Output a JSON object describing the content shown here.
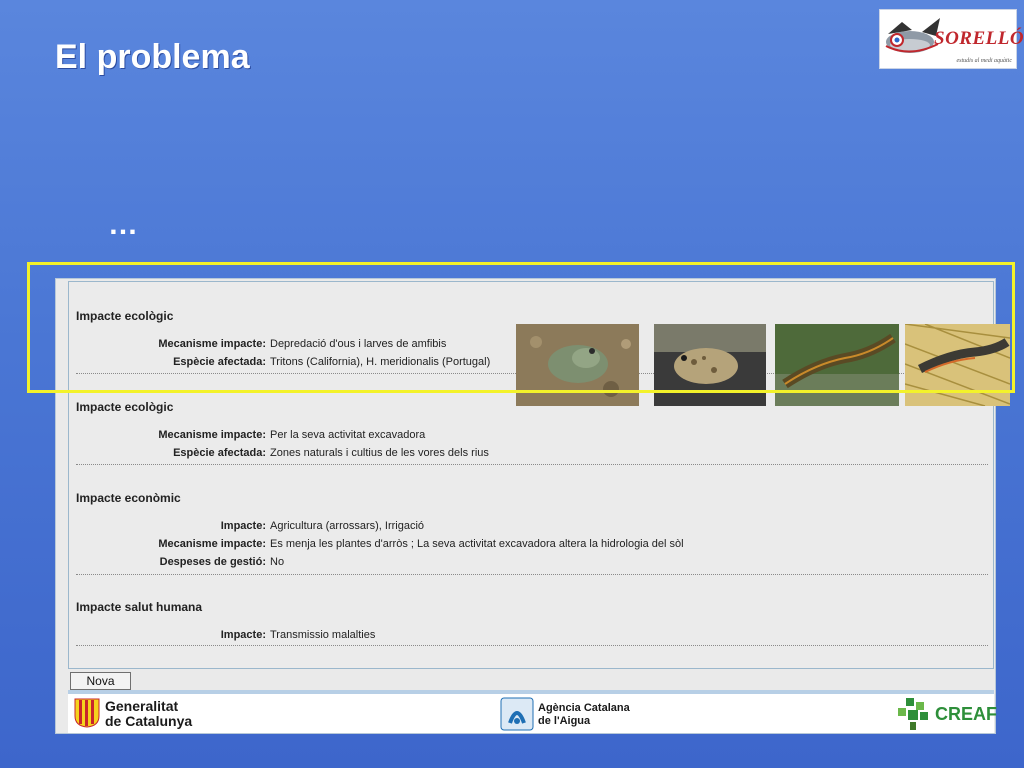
{
  "slide": {
    "title": "El problema",
    "ellipsis": "…"
  },
  "logo": {
    "brand": "SORELLÓ",
    "tagline": "estudis al medi aquàtic"
  },
  "impacts": [
    {
      "heading": "Impacte ecològic",
      "rows": [
        {
          "label": "Mecanisme impacte:",
          "value": "Depredació d'ous i larves de amfibis"
        },
        {
          "label": "Espècie afectada:",
          "value": "Tritons (California), H. meridionalis (Portugal)"
        }
      ]
    },
    {
      "heading": "Impacte ecològic",
      "rows": [
        {
          "label": "Mecanisme impacte:",
          "value": "Per la seva activitat excavadora"
        },
        {
          "label": "Espècie afectada:",
          "value": "Zones naturals i cultius de les vores dels rius"
        }
      ]
    },
    {
      "heading": "Impacte econòmic",
      "rows": [
        {
          "label": "Impacte:",
          "value": "Agricultura (arrossars), Irrigació"
        },
        {
          "label": "Mecanisme impacte:",
          "value": "Es menja les plantes d'arròs ; La seva activitat excavadora altera la hidrologia del sòl"
        },
        {
          "label": "Despeses de gestió:",
          "value": "No"
        }
      ]
    },
    {
      "heading": "Impacte salut humana",
      "rows": [
        {
          "label": "Impacte:",
          "value": "Transmissio malalties"
        }
      ]
    }
  ],
  "photos": [
    "frog-photo",
    "toad-photo",
    "newt-photo",
    "newt-net-photo"
  ],
  "buttons": {
    "new_search": "Nova cerca"
  },
  "footer": {
    "generalitat_line1": "Generalitat",
    "generalitat_line2": "de Catalunya",
    "aca_line1": "Agència Catalana",
    "aca_line2": "de l'Aigua",
    "creaf": "CREAF"
  },
  "colors": {
    "slide_bg": "#4a76d4",
    "highlight": "#f3f22a",
    "brand_red": "#c0272d",
    "creaf_green": "#2e8f3a"
  }
}
